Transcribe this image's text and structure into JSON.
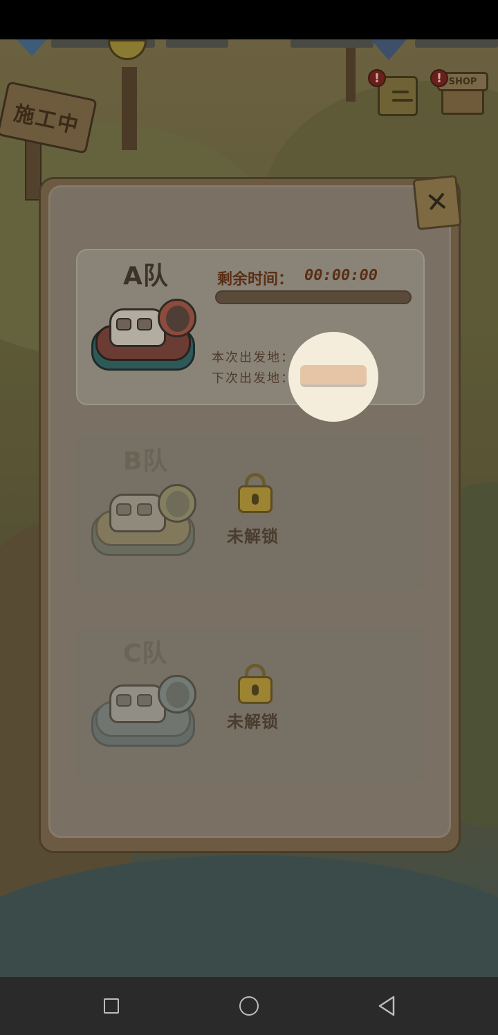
{
  "game": {
    "sign_text": "施工中",
    "shop_label": "SHOP",
    "alert_mark": "!"
  },
  "panel": {
    "close_label": "✕",
    "teams": [
      {
        "title": "A队",
        "remaining_time_label": "剩余时间：",
        "remaining_time_value": "00:00:00",
        "progress": 0,
        "this_departure_label": "本次出发地：",
        "next_departure_label": "下次出发地："
      },
      {
        "title": "B队",
        "status": "未解锁"
      },
      {
        "title": "C队",
        "status": "未解锁"
      }
    ]
  },
  "nav": {
    "recent_icon": "square-icon",
    "home_icon": "circle-icon",
    "back_icon": "triangle-back-icon"
  }
}
